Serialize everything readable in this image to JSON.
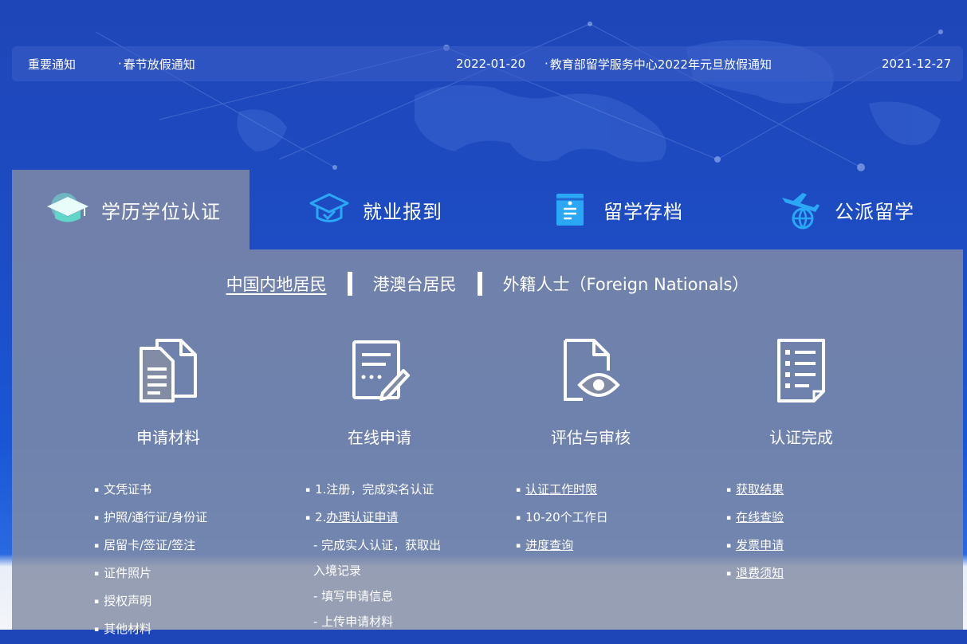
{
  "notices": {
    "label": "重要通知",
    "items": [
      {
        "title": "春节放假通知",
        "date": "2022-01-20"
      },
      {
        "title": "教育部留学服务中心2022年元旦放假通知",
        "date": "2021-12-27"
      }
    ]
  },
  "tabs": [
    {
      "label": "学历学位认证",
      "icon": "graduation-cap-icon",
      "active": true
    },
    {
      "label": "就业报到",
      "icon": "student-cap-icon",
      "active": false
    },
    {
      "label": "留学存档",
      "icon": "archive-document-icon",
      "active": false
    },
    {
      "label": "公派留学",
      "icon": "plane-globe-icon",
      "active": false
    }
  ],
  "sub_tabs": [
    {
      "label": "中国内地居民",
      "active": true
    },
    {
      "label": "港澳台居民",
      "active": false
    },
    {
      "label": "外籍人士（Foreign Nationals）",
      "active": false
    }
  ],
  "steps": [
    {
      "title": "申请材料",
      "icon": "documents-icon"
    },
    {
      "title": "在线申请",
      "icon": "edit-form-icon"
    },
    {
      "title": "评估与审核",
      "icon": "file-eye-icon"
    },
    {
      "title": "认证完成",
      "icon": "checklist-icon"
    }
  ],
  "columns": {
    "materials": [
      "文凭证书",
      "护照/通行证/身份证",
      "居留卡/签证/签注",
      "证件照片",
      "授权声明",
      "其他材料"
    ],
    "apply": {
      "step1": "1.注册，完成实名认证",
      "step2_prefix": "2.",
      "step2_link": "办理认证申请",
      "sub1a": "- 完成实人认证，获取出",
      "sub1b": "入境记录",
      "sub2": "- 填写申请信息",
      "sub3": "- 上传申请材料"
    },
    "review": {
      "link1": "认证工作时限",
      "text2": "10-20个工作日",
      "link3": "进度查询"
    },
    "complete": [
      "获取结果",
      "在线查验",
      "发票申请",
      "退费须知"
    ]
  },
  "colors": {
    "background": "#1f46b8",
    "panel": "rgba(130,140,165,0.82)",
    "accent_icon": "#2aa7f5",
    "mint_icon": "#6fe0d6"
  }
}
